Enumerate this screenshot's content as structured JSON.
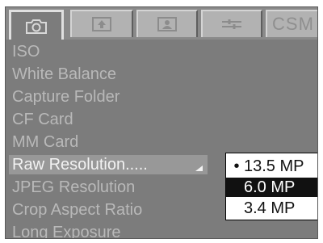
{
  "tabs": [
    {
      "name": "camera",
      "icon": "camera-icon"
    },
    {
      "name": "playback",
      "icon": "upload-card-icon"
    },
    {
      "name": "user",
      "icon": "person-card-icon"
    },
    {
      "name": "tools",
      "icon": "wrench-icon"
    },
    {
      "name": "csm",
      "label": "CSM"
    }
  ],
  "menu": {
    "items": [
      "ISO",
      "White Balance",
      "Capture Folder",
      "CF Card",
      "MM Card",
      "Raw Resolution",
      "JPEG Resolution",
      "Crop Aspect Ratio",
      "Long Exposure"
    ],
    "selected_label": "Raw Resolution....."
  },
  "popup": {
    "options": [
      "13.5 MP",
      "6.0 MP",
      "3.4 MP"
    ],
    "bullet": "•",
    "current": "13.5 MP",
    "highlighted": "6.0 MP"
  },
  "colors": {
    "background": "#7c7c7c",
    "menu_text": "#b9b9b9",
    "selected_text": "#f2f2f2",
    "highlight": "#111111"
  }
}
